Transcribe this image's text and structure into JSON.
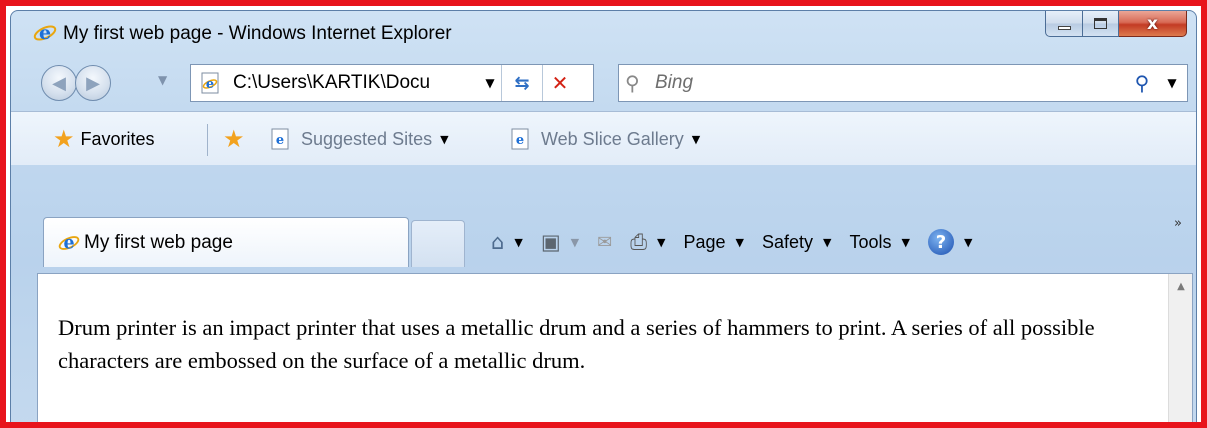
{
  "window": {
    "title": "My first web page - Windows Internet Explorer",
    "close_glyph": "x"
  },
  "nav": {
    "back_icon": "back-arrow-icon",
    "forward_icon": "forward-arrow-icon",
    "address_value": "C:\\Users\\KARTIK\\Docu",
    "search_placeholder": "Bing"
  },
  "favorites_bar": {
    "favorites_label": "Favorites",
    "suggested_sites_label": "Suggested Sites",
    "web_slice_label": "Web Slice Gallery"
  },
  "tabs": [
    {
      "label": "My first web page",
      "active": true
    }
  ],
  "command_bar": {
    "page_label": "Page",
    "safety_label": "Safety",
    "tools_label": "Tools"
  },
  "content": {
    "text": "Drum printer is an impact printer that uses a metallic drum and a series of hammers to print. A series of all possible characters are embossed on the surface of a metallic drum."
  },
  "colors": {
    "frame_border": "#e8141b",
    "chrome": "#c1d8ef",
    "close_button": "#c33b24"
  }
}
